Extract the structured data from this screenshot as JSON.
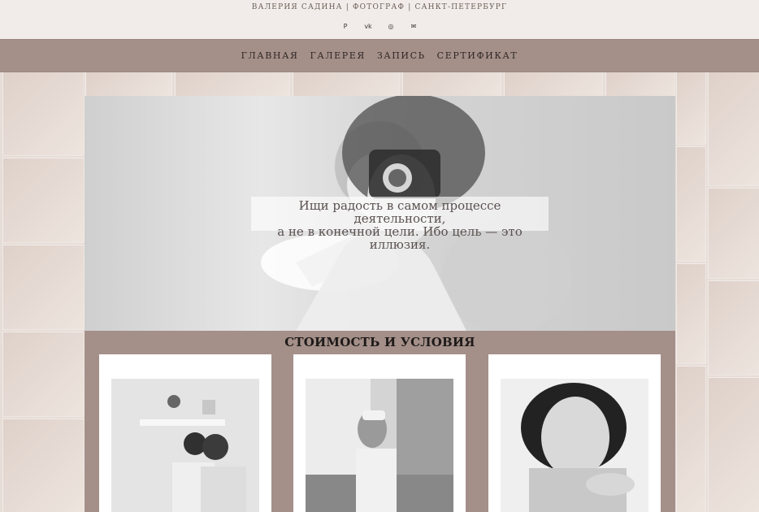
{
  "header": {
    "title": "ВАЛЕРИЯ САДИНА | ФОТОГРАФ | САНКТ-ПЕТЕРБУРГ",
    "social": [
      {
        "name": "pinterest-icon",
        "glyph": "P"
      },
      {
        "name": "vk-icon",
        "glyph": "vk"
      },
      {
        "name": "instagram-icon",
        "glyph": "◎"
      },
      {
        "name": "mail-icon",
        "glyph": "✉"
      }
    ]
  },
  "nav": {
    "items": [
      "ГЛАВНАЯ",
      "ГАЛЕРЕЯ",
      "ЗАПИСЬ",
      "СЕРТИФИКАТ"
    ]
  },
  "hero": {
    "quote_line_1": "Ищи радость в самом процессе деятельности,",
    "quote_line_2": "а не в конечной цели. Ибо цель — это иллюзия."
  },
  "section": {
    "title": "СТОИМОСТЬ И УСЛОВИЯ"
  },
  "colors": {
    "header_bg": "#f1ece9",
    "nav_bg": "#a48f89",
    "text_dark": "#2f2725"
  }
}
